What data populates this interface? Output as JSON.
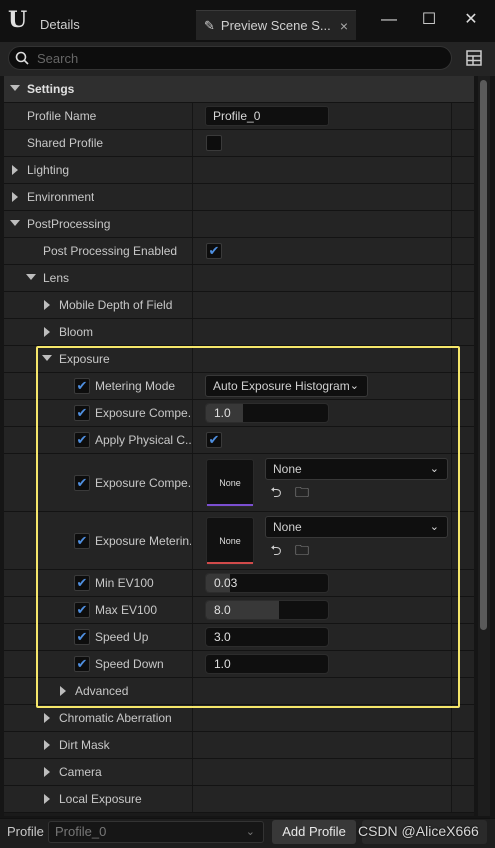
{
  "titlebar": {
    "tab_details": "Details",
    "tab_preview": "Preview Scene S...",
    "close_tab": "×",
    "minimize": "—",
    "maximize": "☐",
    "close_window": "✕"
  },
  "search": {
    "placeholder": "Search"
  },
  "settings": {
    "header": "Settings",
    "profile_name_label": "Profile Name",
    "profile_name_value": "Profile_0",
    "shared_profile_label": "Shared Profile",
    "lighting": "Lighting",
    "environment": "Environment",
    "postprocessing": "PostProcessing",
    "pp_enabled_label": "Post Processing Enabled",
    "lens": "Lens",
    "mobile_dof": "Mobile Depth of Field",
    "bloom": "Bloom",
    "exposure": "Exposure",
    "metering_mode_label": "Metering Mode",
    "metering_mode_value": "Auto Exposure Histogram",
    "exposure_comp_label": "Exposure Compe...",
    "exposure_comp_value": "1.0",
    "apply_phys_label": "Apply Physical C...",
    "exposure_comp_curve_label": "Exposure Compe...",
    "exposure_comp_curve_value": "None",
    "exposure_comp_curve_thumb": "None",
    "exposure_meter_label": "Exposure Meterin...",
    "exposure_meter_value": "None",
    "exposure_meter_thumb": "None",
    "min_ev_label": "Min EV100",
    "min_ev_value": "0.03",
    "max_ev_label": "Max EV100",
    "max_ev_value": "8.0",
    "speed_up_label": "Speed Up",
    "speed_up_value": "3.0",
    "speed_down_label": "Speed Down",
    "speed_down_value": "1.0",
    "advanced": "Advanced",
    "chromatic": "Chromatic Aberration",
    "dirt_mask": "Dirt Mask",
    "camera": "Camera",
    "local_exposure": "Local Exposure"
  },
  "bottom": {
    "profile_label": "Profile",
    "profile_value": "Profile_0",
    "add_profile": "Add Profile",
    "watermark": "CSDN @AliceX666"
  },
  "colors": {
    "highlight": "#f5e66a",
    "check": "#4f8fe0",
    "curve_bar": "#7b4fd0",
    "meter_bar": "#d04a4a"
  },
  "fills": {
    "exposure_comp": 0.3,
    "min_ev": 0.2,
    "max_ev": 0.6
  }
}
